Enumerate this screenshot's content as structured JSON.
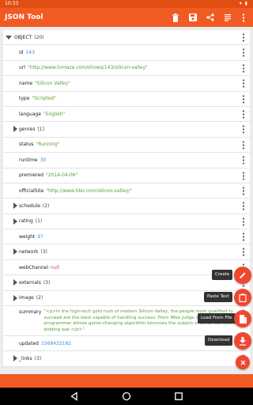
{
  "status_bar": {
    "time": "10:33",
    "indicators": "▾ ▮"
  },
  "app": {
    "title": "JSON Tool",
    "accent": "#f15a22"
  },
  "toolbar": [
    "trash-icon",
    "save-icon",
    "share-icon",
    "list-icon",
    "more-vert-icon"
  ],
  "tree": {
    "root": {
      "key": "OBJECT",
      "count": "(20)"
    },
    "rows": [
      {
        "key": "id",
        "value": "143",
        "kind": "num",
        "expandable": false
      },
      {
        "key": "url",
        "value": "\"http://www.tvmaze.com/shows/143/silicon-valley\"",
        "kind": "str",
        "expandable": false
      },
      {
        "key": "name",
        "value": "\"Silicon Valley\"",
        "kind": "str",
        "expandable": false
      },
      {
        "key": "type",
        "value": "\"Scripted\"",
        "kind": "str",
        "expandable": false
      },
      {
        "key": "language",
        "value": "\"English\"",
        "kind": "str",
        "expandable": false
      },
      {
        "key": "genres",
        "value": "[1]",
        "kind": "cnt",
        "expandable": true
      },
      {
        "key": "status",
        "value": "\"Running\"",
        "kind": "str",
        "expandable": false
      },
      {
        "key": "runtime",
        "value": "30",
        "kind": "num",
        "expandable": false
      },
      {
        "key": "premiered",
        "value": "\"2014-04-06\"",
        "kind": "str",
        "expandable": false
      },
      {
        "key": "officialSite",
        "value": "\"http://www.hbo.com/silicon-valley/\"",
        "kind": "str",
        "expandable": false
      },
      {
        "key": "schedule",
        "value": "(2)",
        "kind": "cnt",
        "expandable": true
      },
      {
        "key": "rating",
        "value": "(1)",
        "kind": "cnt",
        "expandable": true
      },
      {
        "key": "weight",
        "value": "97",
        "kind": "num",
        "expandable": false
      },
      {
        "key": "network",
        "value": "(3)",
        "kind": "cnt",
        "expandable": true
      },
      {
        "key": "webChannel",
        "value": "null",
        "kind": "null",
        "expandable": false
      },
      {
        "key": "externals",
        "value": "(3)",
        "kind": "cnt",
        "expandable": true
      },
      {
        "key": "image",
        "value": "(2)",
        "kind": "cnt",
        "expandable": true
      }
    ],
    "summary": {
      "key": "summary",
      "value": "\"<p>In the high-tech gold rush of modern Silicon Valley, the people most qualified to succeed are the least capable of handling success. From Mike Judge comes a satire about a programmer whose game-changing algorithm becomes the subject of an all-out valley-wide bidding war.</p>\""
    },
    "rows_after": [
      {
        "key": "updated",
        "value": "1568432182",
        "kind": "num",
        "expandable": false
      },
      {
        "key": "_links",
        "value": "(3)",
        "kind": "cnt",
        "expandable": true
      }
    ]
  },
  "fab_menu": {
    "create": "Create",
    "paste": "Paste Text",
    "load": "Load From File",
    "download": "Download"
  }
}
